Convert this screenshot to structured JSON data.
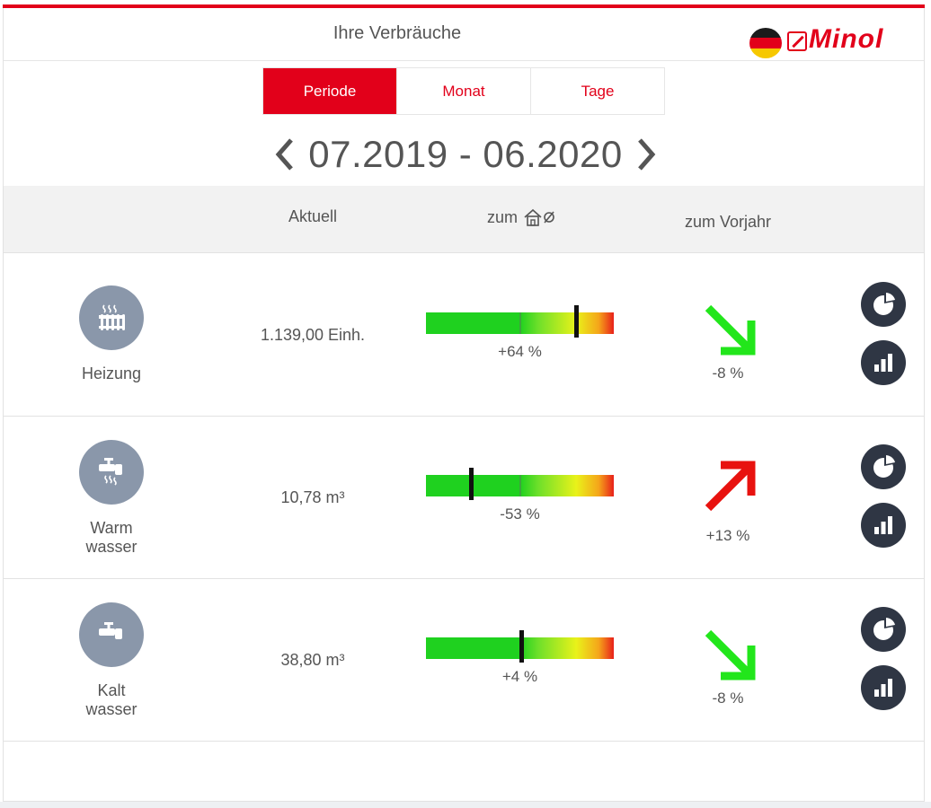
{
  "header": {
    "title": "Ihre Verbräuche",
    "logo_text": "Minol"
  },
  "tabs": [
    {
      "label": "Periode",
      "active": true
    },
    {
      "label": "Monat",
      "active": false
    },
    {
      "label": "Tage",
      "active": false
    }
  ],
  "period": {
    "label": "07.2019 - 06.2020"
  },
  "columns": {
    "aktuell": "Aktuell",
    "zum": "zum",
    "zum_icon": "house-average-icon",
    "vorjahr": "zum Vorjahr"
  },
  "rows": [
    {
      "name": "Heizung",
      "icon": "radiator-icon",
      "value": "1.139,00 Einh.",
      "avg_pct": "+64 %",
      "avg_marker_fraction": 0.8,
      "trend_pct": "-8 %",
      "trend": "down",
      "trend_color": "#22e61b"
    },
    {
      "name": "Warm\nwasser",
      "name_line1": "Warm",
      "name_line2": "wasser",
      "icon": "hot-water-tap-icon",
      "value": "10,78 m³",
      "avg_pct": "-53 %",
      "avg_marker_fraction": 0.24,
      "trend_pct": "+13 %",
      "trend": "up",
      "trend_color": "#e8120f"
    },
    {
      "name": "Kalt\nwasser",
      "name_line1": "Kalt",
      "name_line2": "wasser",
      "icon": "cold-water-tap-icon",
      "value": "38,80 m³",
      "avg_pct": "+4 %",
      "avg_marker_fraction": 0.51,
      "trend_pct": "-8 %",
      "trend": "down",
      "trend_color": "#22e61b"
    }
  ],
  "colors": {
    "accent": "#e2001a",
    "icon_circle": "#8a97aa",
    "action_button": "#2f3644"
  }
}
